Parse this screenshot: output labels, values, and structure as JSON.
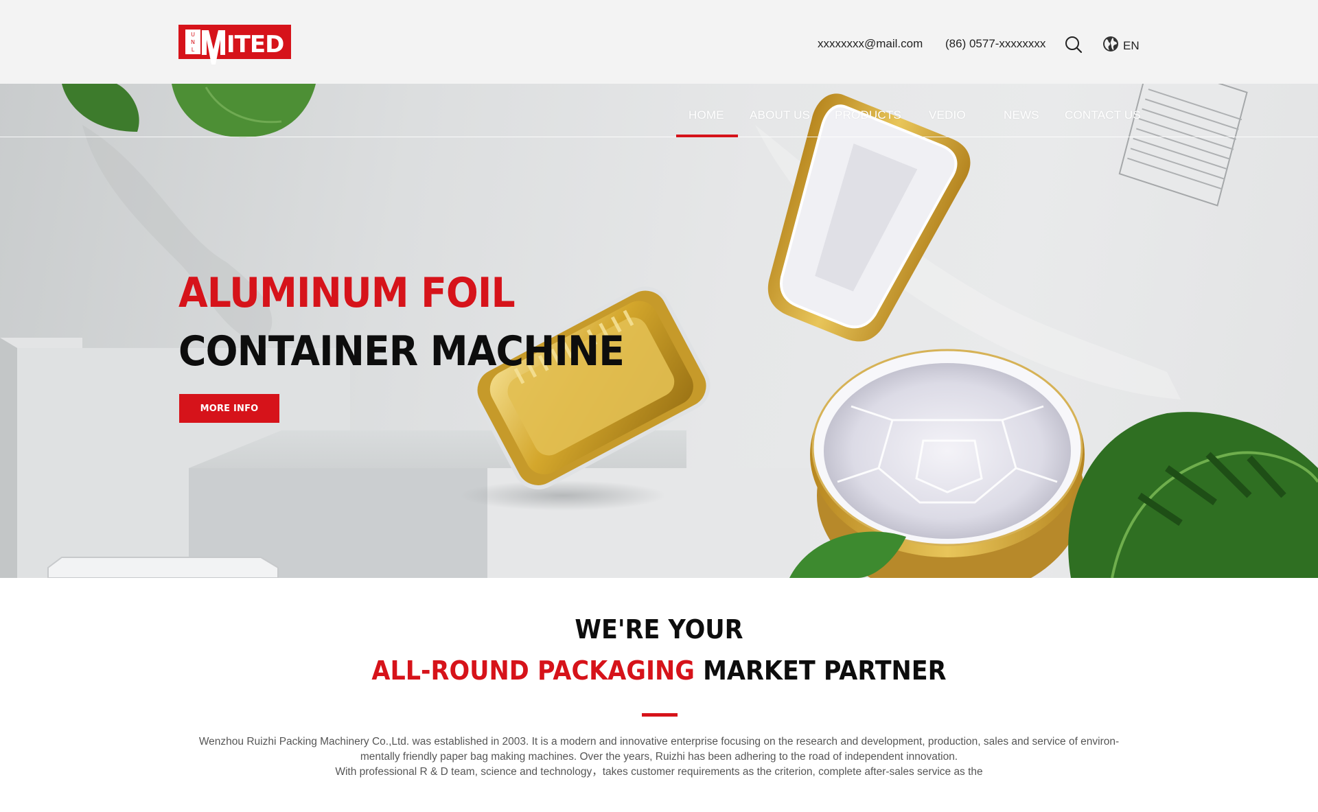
{
  "header": {
    "logo_text": "UNLIMITED",
    "email": "xxxxxxxx@mail.com",
    "phone": "(86) 0577-xxxxxxxx",
    "language": "EN"
  },
  "nav": {
    "items": [
      {
        "label": "HOME",
        "active": true
      },
      {
        "label": "ABOUT US"
      },
      {
        "label": "PRODUCTS"
      },
      {
        "label": "VEDIO"
      },
      {
        "label": "NEWS"
      },
      {
        "label": "CONTACT US"
      }
    ]
  },
  "hero": {
    "title_red": "ALUMINUM FOIL",
    "title_black": "CONTAINER MACHINE",
    "button_label": "MORE INFO"
  },
  "intro": {
    "heading_line1": "WE'RE YOUR",
    "heading_line2_red": "ALL-ROUND PACKAGING",
    "heading_line2_black": "MARKET PARTNER",
    "body_line1": "Wenzhou Ruizhi Packing Machinery Co.,Ltd. was established in 2003. It is a modern and innovative enterprise focusing on the research and development, production, sales and service of environ-",
    "body_line2": "mentally friendly paper bag making machines. Over the years, Ruizhi has been adhering to the road of independent innovation.",
    "body_line3": "With professional R & D team, science and technology，takes customer requirements as the criterion, complete after-sales service as the"
  },
  "colors": {
    "accent": "#d6131a",
    "topbar_bg": "#f3f3f3",
    "text_dark": "#0d0d0d",
    "gold": "#d4a72c"
  },
  "icons": [
    "search-icon",
    "globe-icon"
  ]
}
